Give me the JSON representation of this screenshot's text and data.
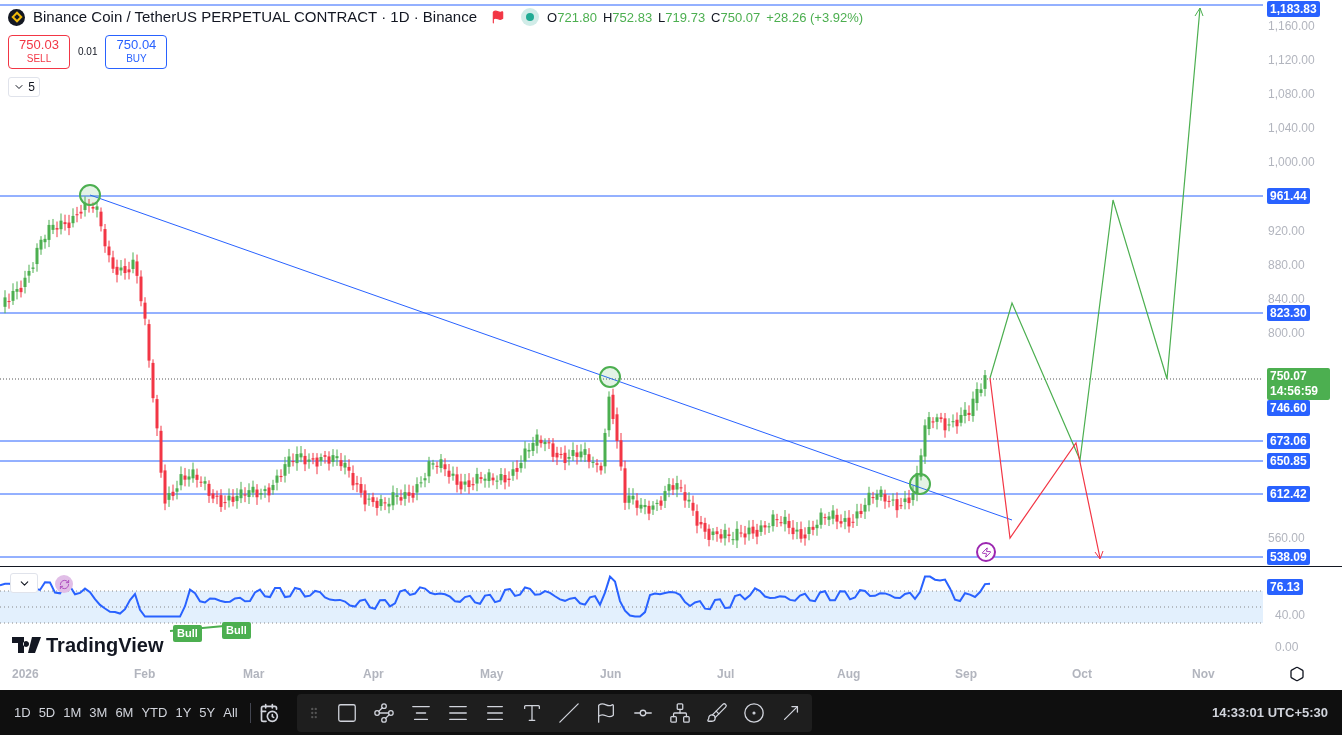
{
  "header": {
    "title": "Binance Coin / TetherUS PERPETUAL CONTRACT · 1D · Binance",
    "ohlc": [
      {
        "label": "O",
        "value": "721.80"
      },
      {
        "label": "H",
        "value": "752.83"
      },
      {
        "label": "L",
        "value": "719.73"
      },
      {
        "label": "C",
        "value": "750.07"
      }
    ],
    "change": "+28.26 (+3.92%)"
  },
  "trade": {
    "sell_price": "750.03",
    "sell_label": "SELL",
    "spread": "0.01",
    "buy_price": "750.04",
    "buy_label": "BUY"
  },
  "indicators_toggle": {
    "count": "5"
  },
  "price_axis": {
    "ticks": [
      "1,160.00",
      "1,120.00",
      "1,080.00",
      "1,040.00",
      "1,000.00",
      "920.00",
      "880.00",
      "840.00",
      "800.00",
      "560.00"
    ],
    "levels": [
      {
        "value": "1,183.83"
      },
      {
        "value": "961.44"
      },
      {
        "value": "823.30"
      },
      {
        "value": "746.60"
      },
      {
        "value": "673.06"
      },
      {
        "value": "650.85"
      },
      {
        "value": "612.42"
      },
      {
        "value": "538.09"
      }
    ],
    "current": {
      "price": "750.07",
      "countdown": "14:56:59"
    }
  },
  "rsi": {
    "value": "76.13",
    "ticks": [
      "40.00",
      "0.00"
    ],
    "signals": [
      "Bull",
      "Bull"
    ]
  },
  "logo_text": "TradingView",
  "time_axis": [
    "2026",
    "Feb",
    "Mar",
    "Apr",
    "May",
    "Jun",
    "Jul",
    "Aug",
    "Sep",
    "Oct",
    "Nov"
  ],
  "toolbar": {
    "ranges": [
      "1D",
      "5D",
      "1M",
      "3M",
      "6M",
      "YTD",
      "1Y",
      "5Y",
      "All"
    ],
    "clock": "14:33:01 UTC+5:30"
  }
}
